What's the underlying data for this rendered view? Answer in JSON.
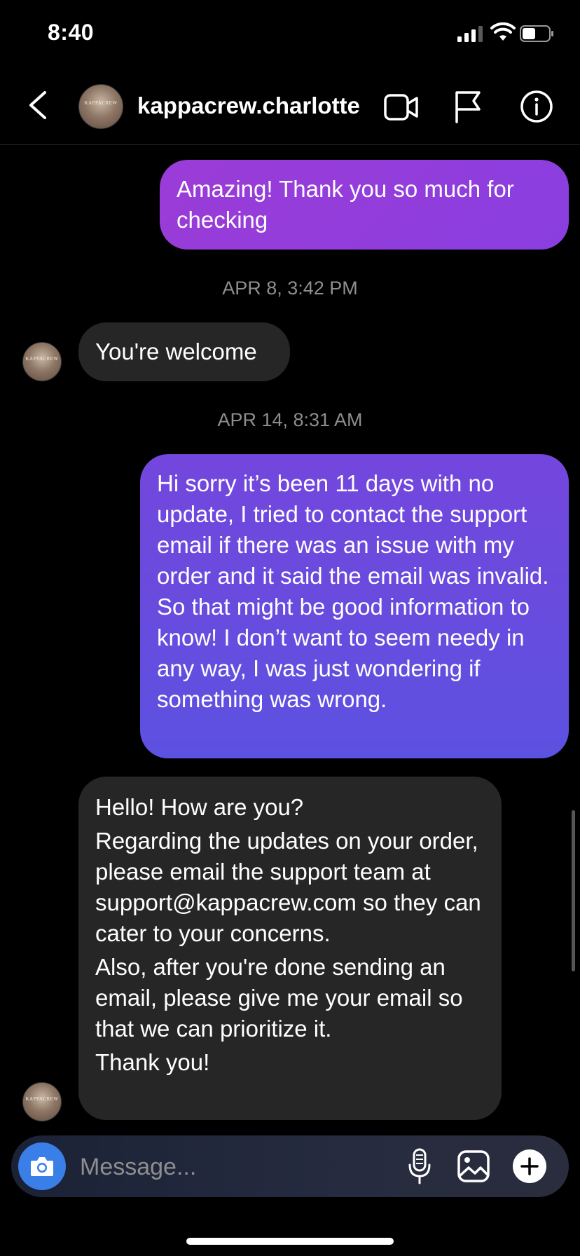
{
  "status_bar": {
    "time": "8:40",
    "icons": [
      "signal-icon",
      "wifi-icon",
      "battery-icon"
    ]
  },
  "header": {
    "username": "kappacrew.charlotte",
    "avatar_mark": "KAPPACREW",
    "icons": [
      "back-icon",
      "video-call-icon",
      "flag-icon",
      "info-icon"
    ]
  },
  "messages": [
    {
      "direction": "outgoing",
      "text": "Amazing! Thank you so much for checking"
    },
    {
      "type": "timestamp",
      "text": "APR 8, 3:42 PM"
    },
    {
      "direction": "incoming",
      "text": "You're welcome"
    },
    {
      "type": "timestamp",
      "text": "APR 14, 8:31 AM"
    },
    {
      "direction": "outgoing",
      "text": "Hi sorry it’s been 11 days with no update, I tried to contact the support email if there was an issue with my order and it said the email was invalid. So that might be good information to know! I don’t want to seem needy in any way, I was just wondering if something was wrong."
    },
    {
      "direction": "incoming",
      "lines": [
        "Hello! How are you?",
        "Regarding the updates on your order, please email the support team at support@kappacrew.com so they can cater to your concerns.",
        "Also, after you're done sending an email, please give me your email so that we can prioritize it.",
        "Thank you!"
      ]
    }
  ],
  "composer": {
    "placeholder": "Message...",
    "icons": [
      "camera-icon",
      "microphone-icon",
      "gallery-icon",
      "plus-icon"
    ]
  },
  "colors": {
    "background": "#000000",
    "incoming_bubble": "#262626",
    "outgoing_gradient_top": "#9b3cd7",
    "outgoing_gradient_bottom": "#5c51e0",
    "timestamp": "#8e8e8e",
    "camera_button": "#3a7fe8"
  }
}
